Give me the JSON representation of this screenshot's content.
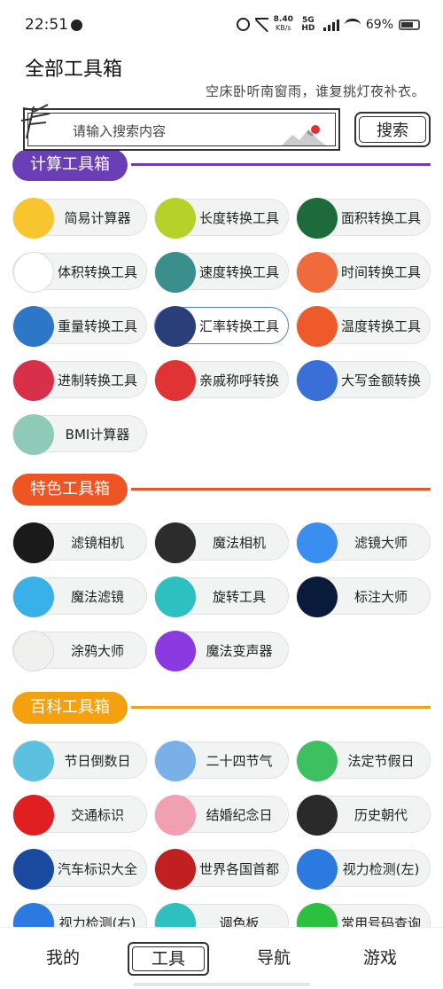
{
  "status": {
    "time": "22:51",
    "speed_value": "8.40",
    "speed_unit": "KB/s",
    "network": "5G HD",
    "battery": "69%"
  },
  "header": {
    "title": "全部工具箱",
    "subtitle": "空床卧听南窗雨，谁复挑灯夜补衣。"
  },
  "search": {
    "placeholder": "请输入搜索内容",
    "button_label": "搜索"
  },
  "sections": [
    {
      "title": "计算工具箱",
      "color": "#6a3fb5",
      "tools": [
        {
          "label": "简易计算器",
          "icon": "calculator-icon",
          "color": "#f7c62f"
        },
        {
          "label": "长度转换工具",
          "icon": "ruler-icon",
          "color": "#b5d12a"
        },
        {
          "label": "面积转换工具",
          "icon": "radar-icon",
          "color": "#1d6b3a"
        },
        {
          "label": "体积转换工具",
          "icon": "box-icon",
          "color": "#ffffff"
        },
        {
          "label": "速度转换工具",
          "icon": "truck-icon",
          "color": "#3a8f8c"
        },
        {
          "label": "时间转换工具",
          "icon": "clock-icon",
          "color": "#ef6b3b"
        },
        {
          "label": "重量转换工具",
          "icon": "weight-icon",
          "color": "#2e77c8"
        },
        {
          "label": "汇率转换工具",
          "icon": "exchange-icon",
          "color": "#2a3f7a"
        },
        {
          "label": "温度转换工具",
          "icon": "temperature-icon",
          "color": "#ee5a2a"
        },
        {
          "label": "进制转换工具",
          "icon": "convert-icon",
          "color": "#d8304a"
        },
        {
          "label": "亲戚称呼转换",
          "icon": "person-icon",
          "color": "#e03434"
        },
        {
          "label": "大写金额转换",
          "icon": "yuan-icon",
          "color": "#3a6fd8"
        },
        {
          "label": "BMI计算器",
          "icon": "scale-icon",
          "color": "#8fcab8"
        }
      ]
    },
    {
      "title": "特色工具箱",
      "color": "#ee5522",
      "tools": [
        {
          "label": "滤镜相机",
          "icon": "camera-lens-icon",
          "color": "#1a1a1a"
        },
        {
          "label": "魔法相机",
          "icon": "camera-icon",
          "color": "#2c2c2c"
        },
        {
          "label": "滤镜大师",
          "icon": "filter-icon",
          "color": "#3a8ef0"
        },
        {
          "label": "魔法滤镜",
          "icon": "planet-icon",
          "color": "#3ab0e8"
        },
        {
          "label": "旋转工具",
          "icon": "rotate-icon",
          "color": "#2cc0c0"
        },
        {
          "label": "标注大师",
          "icon": "photoshop-icon",
          "color": "#0a1a3a"
        },
        {
          "label": "涂鸦大师",
          "icon": "palette-icon",
          "color": "#f0f0ee"
        },
        {
          "label": "魔法变声器",
          "icon": "microphone-icon",
          "color": "#8a3ae0"
        }
      ]
    },
    {
      "title": "百科工具箱",
      "color": "#f5a00f",
      "tools": [
        {
          "label": "节日倒数日",
          "icon": "festival-icon",
          "color": "#5cc0e0"
        },
        {
          "label": "二十四节气",
          "icon": "season-icon",
          "color": "#7ab0e8"
        },
        {
          "label": "法定节假日",
          "icon": "holiday-icon",
          "color": "#3cc060"
        },
        {
          "label": "交通标识",
          "icon": "no-entry-icon",
          "color": "#e02020"
        },
        {
          "label": "结婚纪念日",
          "icon": "wedding-icon",
          "color": "#f0a0b0"
        },
        {
          "label": "历史朝代",
          "icon": "emperor-icon",
          "color": "#2a2a2a"
        },
        {
          "label": "汽车标识大全",
          "icon": "car-logo-icon",
          "color": "#1a4aa0"
        },
        {
          "label": "世界各国首都",
          "icon": "palace-icon",
          "color": "#c02020"
        },
        {
          "label": "视力检测(左)",
          "icon": "eye-icon",
          "color": "#2a7ae0"
        },
        {
          "label": "视力检测(右)",
          "icon": "eye-icon",
          "color": "#2a7ae0"
        },
        {
          "label": "调色板",
          "icon": "color-board-icon",
          "color": "#2cc0c0"
        },
        {
          "label": "常用号码查询",
          "icon": "phone-icon",
          "color": "#2cc040"
        }
      ]
    }
  ],
  "bottom_nav": [
    {
      "label": "我的"
    },
    {
      "label": "工具"
    },
    {
      "label": "导航"
    },
    {
      "label": "游戏"
    }
  ]
}
